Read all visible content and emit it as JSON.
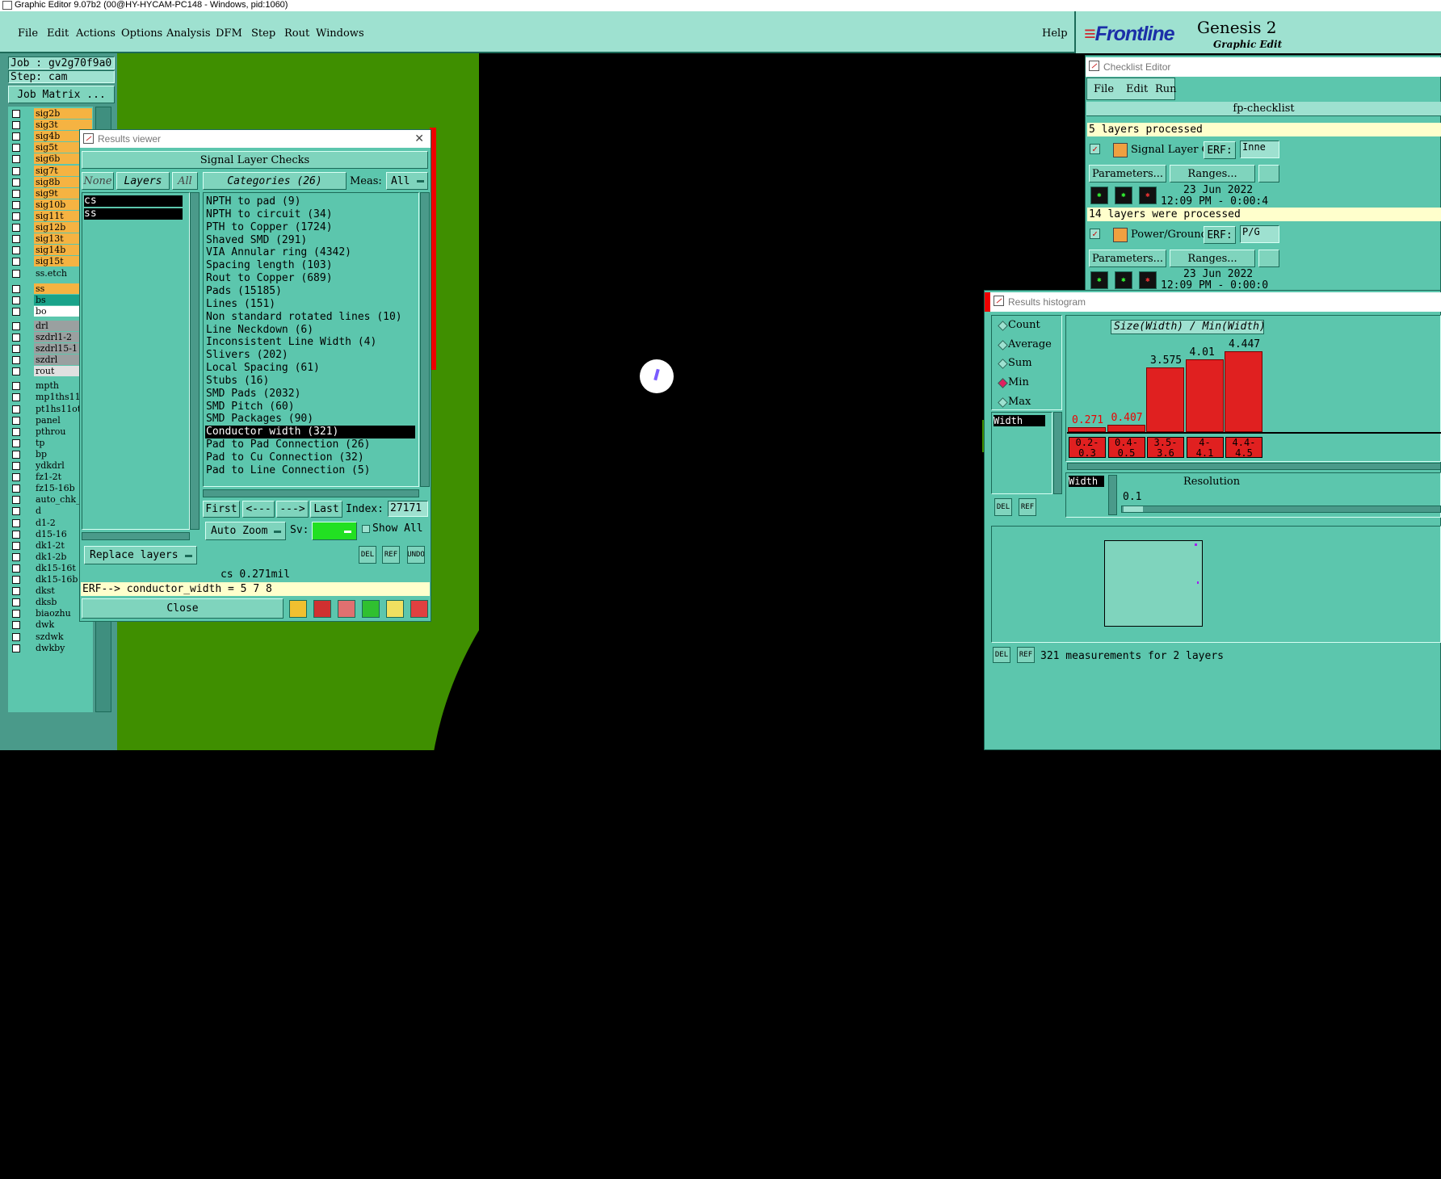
{
  "window_title": "Graphic Editor 9.07b2 (00@HY-HYCAM-PC148 - Windows, pid:1060)",
  "menu": [
    "File",
    "Edit",
    "Actions",
    "Options",
    "Analysis",
    "DFM",
    "Step",
    "Rout",
    "Windows"
  ],
  "help": "Help",
  "brand": {
    "logo": "Frontline",
    "product": "Genesis 2",
    "subtitle": "Graphic Edit"
  },
  "job": {
    "job_label": "Job : gv2g70f9a0",
    "step_label": "Step: cam",
    "matrix_button": "Job Matrix ..."
  },
  "layers": [
    {
      "name": "sig2b",
      "color": "#f5b342"
    },
    {
      "name": "sig3t",
      "color": "#f5b342"
    },
    {
      "name": "sig4b",
      "color": "#f5b342"
    },
    {
      "name": "sig5t",
      "color": "#f5b342"
    },
    {
      "name": "sig6b",
      "color": "#f5b342"
    },
    {
      "name": "sig7t",
      "color": "#f5b342"
    },
    {
      "name": "sig8b",
      "color": "#f5b342"
    },
    {
      "name": "sig9t",
      "color": "#f5b342"
    },
    {
      "name": "sig10b",
      "color": "#f5b342"
    },
    {
      "name": "sig11t",
      "color": "#f5b342"
    },
    {
      "name": "sig12b",
      "color": "#f5b342"
    },
    {
      "name": "sig13t",
      "color": "#f5b342"
    },
    {
      "name": "sig14b",
      "color": "#f5b342"
    },
    {
      "name": "sig15t",
      "color": "#f5b342"
    },
    {
      "name": "ss.etch",
      "color": "#5cc6ad"
    },
    {
      "name": "ss",
      "color": "#f5b342"
    },
    {
      "name": "bs",
      "color": "#1aa38a"
    },
    {
      "name": "bo",
      "color": "#ffffff"
    },
    {
      "name": "drl",
      "color": "#9aa0a0"
    },
    {
      "name": "szdrl1-2",
      "color": "#9aa0a0"
    },
    {
      "name": "szdrl15-1",
      "color": "#9aa0a0"
    },
    {
      "name": "szdrl",
      "color": "#9aa0a0"
    },
    {
      "name": "rout",
      "color": "#e0e0e0"
    },
    {
      "name": "mpth",
      "color": "#5cc6ad"
    },
    {
      "name": "mp1ths11d",
      "color": "#5cc6ad"
    },
    {
      "name": "pt1hs11ot",
      "color": "#5cc6ad"
    },
    {
      "name": "panel",
      "color": "#5cc6ad"
    },
    {
      "name": "pthrou",
      "color": "#5cc6ad"
    },
    {
      "name": "tp",
      "color": "#5cc6ad"
    },
    {
      "name": "bp",
      "color": "#5cc6ad"
    },
    {
      "name": "ydkdrl",
      "color": "#5cc6ad"
    },
    {
      "name": "fz1-2t",
      "color": "#5cc6ad"
    },
    {
      "name": "fz15-16b",
      "color": "#5cc6ad"
    },
    {
      "name": "auto_chk_",
      "color": "#5cc6ad"
    },
    {
      "name": "d",
      "color": "#5cc6ad"
    },
    {
      "name": "d1-2",
      "color": "#5cc6ad"
    },
    {
      "name": "d15-16",
      "color": "#5cc6ad"
    },
    {
      "name": "dk1-2t",
      "color": "#5cc6ad"
    },
    {
      "name": "dk1-2b",
      "color": "#5cc6ad"
    },
    {
      "name": "dk15-16t",
      "color": "#5cc6ad"
    },
    {
      "name": "dk15-16b",
      "color": "#5cc6ad"
    },
    {
      "name": "dkst",
      "color": "#5cc6ad"
    },
    {
      "name": "dksb",
      "color": "#5cc6ad"
    },
    {
      "name": "biaozhu",
      "color": "#5cc6ad"
    },
    {
      "name": "dwk",
      "color": "#5cc6ad"
    },
    {
      "name": "szdwk",
      "color": "#5cc6ad"
    },
    {
      "name": "dwkby",
      "color": "#5cc6ad"
    }
  ],
  "results_viewer": {
    "title": "Results viewer",
    "header": "Signal Layer Checks",
    "none_btn": "None",
    "layers_btn": "Layers",
    "all_btn": "All",
    "categories_btn": "Categories (26)",
    "meas_label": "Meas:",
    "meas_value": "All",
    "layer_list": [
      "cs",
      "ss"
    ],
    "categories": [
      "NPTH to pad (9)",
      "NPTH to circuit (34)",
      "PTH to Copper (1724)",
      "Shaved SMD (291)",
      "VIA Annular ring (4342)",
      "Spacing length (103)",
      "Rout to Copper (689)",
      "Pads (15185)",
      "Lines (151)",
      "Non standard rotated lines (10)",
      "Line Neckdown (6)",
      "Inconsistent Line Width (4)",
      "Slivers (202)",
      "Local Spacing (61)",
      "Stubs (16)",
      "SMD Pads (2032)",
      "SMD Pitch (60)",
      "SMD Packages (90)",
      "Conductor width (321)",
      "Pad to Pad Connection (26)",
      "Pad to Cu Connection (32)",
      "Pad to Line Connection (5)"
    ],
    "selected_category": "Conductor width (321)",
    "first": "First",
    "prev": "<---",
    "next": "--->",
    "last": "Last",
    "index_label": "Index:",
    "index_value": "27171",
    "zoom": "Auto Zoom",
    "sv_label": "Sv:",
    "show_all": "Show All",
    "replace_layers": "Replace layers",
    "icons": [
      "DEL",
      "REF",
      "UNDO"
    ],
    "status": "cs 0.271mil",
    "erf": "ERF--> conductor_width = 5 7 8",
    "close": "Close"
  },
  "checklist": {
    "title": "Checklist Editor",
    "menu": [
      "File",
      "Edit",
      "Run"
    ],
    "name": "fp-checklist",
    "msg1": "5 layers processed",
    "item1": {
      "name": "Signal Layer Ch",
      "erf": "ERF:",
      "erf_val": "Inne"
    },
    "params": "Parameters...",
    "ranges": "Ranges...",
    "date1": "23 Jun 2022",
    "time1": "12:09 PM - 0:00:4",
    "msg2": "14 layers were processed",
    "item2": {
      "name": "Power/Ground C",
      "erf": "ERF:",
      "erf_val": "P/G"
    },
    "date2": "23 Jun 2022",
    "time2": "12:09 PM - 0:00:0"
  },
  "histogram": {
    "title": "Results histogram",
    "modes": [
      "Count",
      "Average",
      "Sum",
      "Min",
      "Max"
    ],
    "selected_mode": "Min",
    "list": [
      "Width"
    ],
    "chart_title": "Size(Width) / Min(Width)",
    "bars": [
      {
        "value": 0.271,
        "label_top": "0.2-",
        "label_bot": "0.3"
      },
      {
        "value": 0.407,
        "label_top": "0.4-",
        "label_bot": "0.5"
      },
      {
        "value": 3.575,
        "label_top": "3.5-",
        "label_bot": "3.6"
      },
      {
        "value": 4.01,
        "label_top": "4-",
        "label_bot": "4.1"
      },
      {
        "value": 4.447,
        "label_top": "4.4-",
        "label_bot": "4.5"
      }
    ],
    "field_label": "Width",
    "resolution_label": "Resolution",
    "resolution_value": "0.1",
    "icons": [
      "DEL",
      "REF"
    ],
    "footer": "321 measurements for 2 layers"
  }
}
